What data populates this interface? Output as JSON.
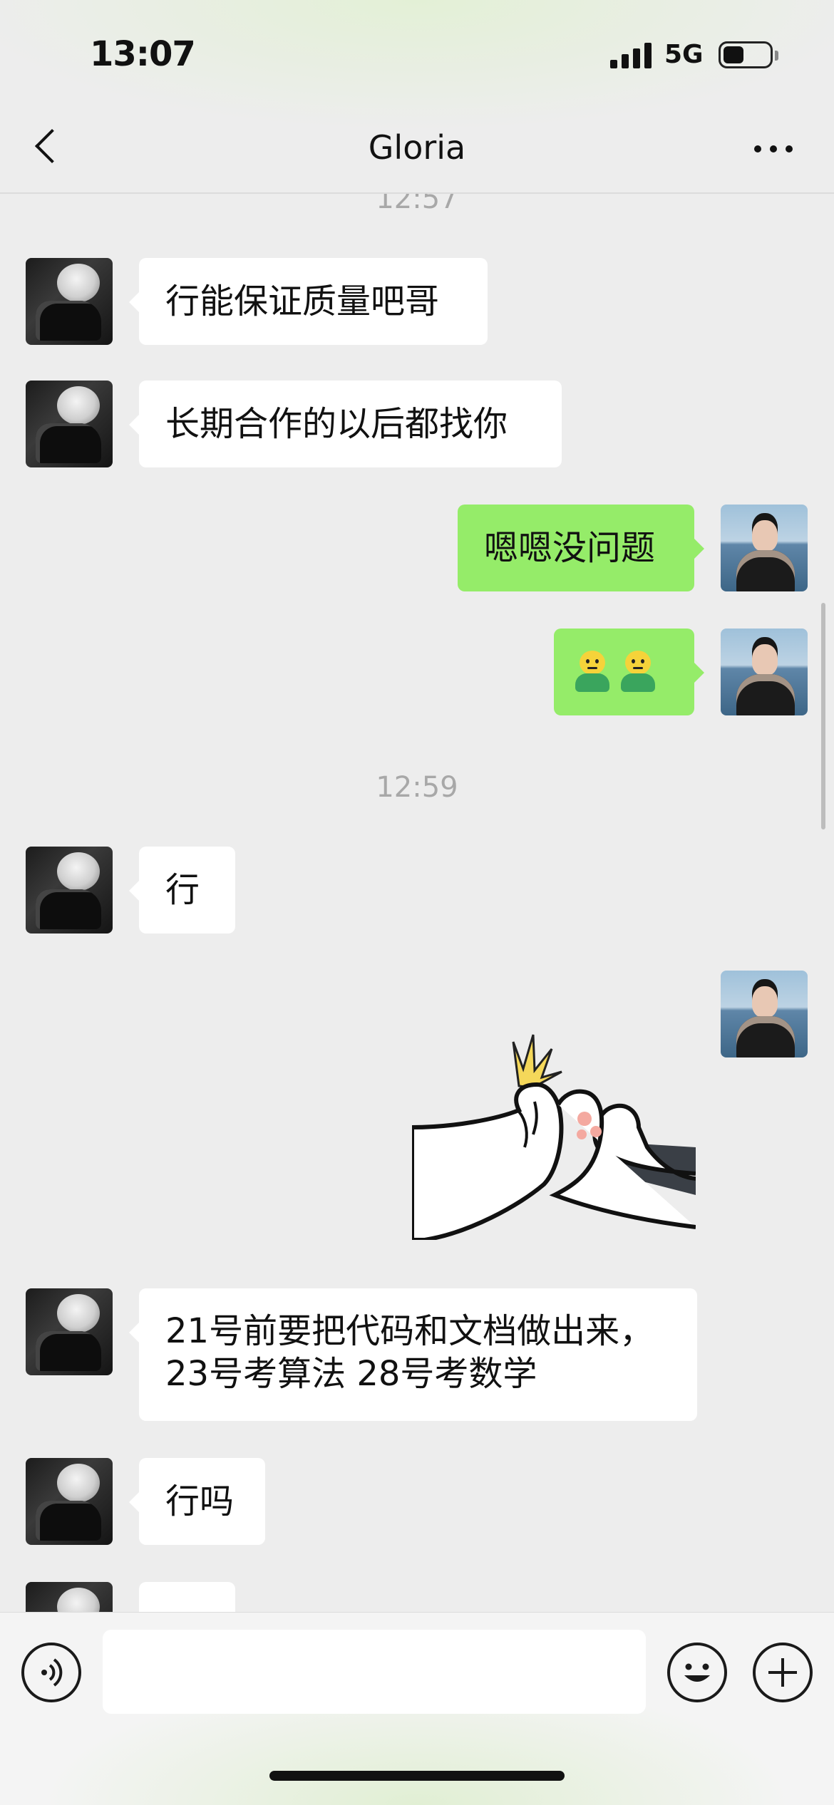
{
  "status_bar": {
    "time": "13:07",
    "network": "5G",
    "battery_level": 0.45,
    "icons": [
      "signal-icon",
      "battery-icon"
    ]
  },
  "header": {
    "back_icon": "chevron-left-icon",
    "title": "Gloria",
    "more_icon": "more-dots-icon"
  },
  "chat": {
    "timestamps": [
      "12:57",
      "12:59"
    ],
    "messages": [
      {
        "from": "Gloria",
        "type": "text",
        "text": "行能保证质量吧哥"
      },
      {
        "from": "Gloria",
        "type": "text",
        "text": "长期合作的以后都找你"
      },
      {
        "from": "me",
        "type": "text",
        "text": "嗯嗯没问题"
      },
      {
        "from": "me",
        "type": "emoji",
        "emoji": [
          "hug-emoji",
          "hug-emoji"
        ]
      },
      {
        "from": "Gloria",
        "type": "text",
        "text": "行"
      },
      {
        "from": "me",
        "type": "sticker",
        "sticker": "paw-fist-bump-sticker"
      },
      {
        "from": "Gloria",
        "type": "text",
        "text": "21号前要把代码和文档做出来，\n23号考算法 28号考数学"
      },
      {
        "from": "Gloria",
        "type": "text",
        "text": "行吗"
      }
    ],
    "colors": {
      "incoming": "#ffffff",
      "outgoing": "#95ec69",
      "background": "#ededed"
    }
  },
  "input_bar": {
    "voice_icon": "voice-icon",
    "text_value": "",
    "emoji_icon": "smiley-icon",
    "plus_icon": "plus-icon"
  }
}
